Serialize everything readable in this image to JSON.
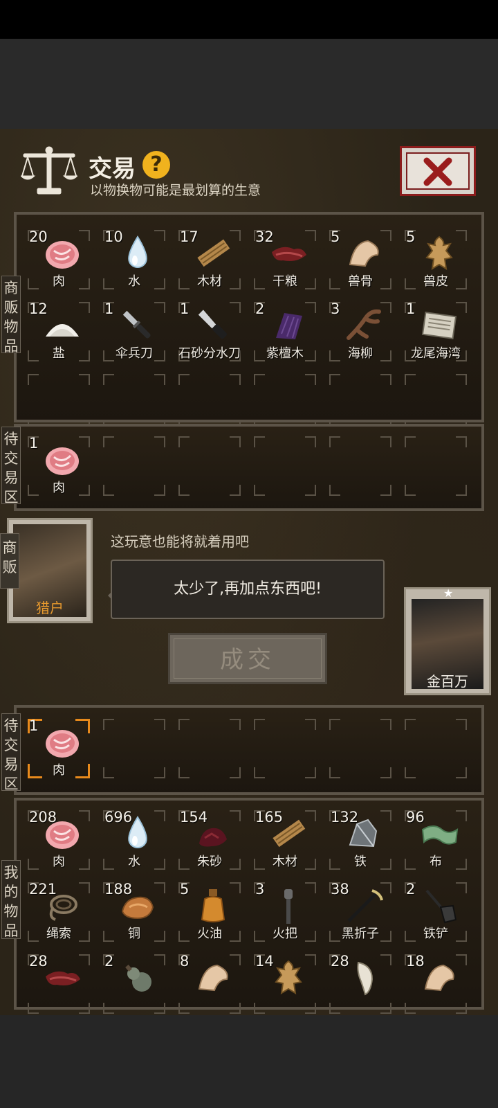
{
  "header": {
    "title": "交易",
    "help": "?",
    "subtitle": "以物换物可能是最划算的生意"
  },
  "labels": {
    "merchant_goods": "商贩物品",
    "pending_top": "待交易区",
    "merchant": "商贩",
    "pending_bottom": "待交易区",
    "my_goods": "我的物品"
  },
  "merchant_items": [
    {
      "qty": "20",
      "name": "肉",
      "icon": "meat-icon"
    },
    {
      "qty": "10",
      "name": "水",
      "icon": "water-icon"
    },
    {
      "qty": "17",
      "name": "木材",
      "icon": "wood-icon"
    },
    {
      "qty": "32",
      "name": "干粮",
      "icon": "jerky-icon"
    },
    {
      "qty": "5",
      "name": "兽骨",
      "icon": "bone-icon"
    },
    {
      "qty": "5",
      "name": "兽皮",
      "icon": "hide-icon"
    },
    {
      "qty": "12",
      "name": "盐",
      "icon": "salt-icon"
    },
    {
      "qty": "1",
      "name": "伞兵刀",
      "icon": "paratrooper-knife-icon"
    },
    {
      "qty": "1",
      "name": "石砂分水刀",
      "icon": "knife-icon"
    },
    {
      "qty": "2",
      "name": "紫檀木",
      "icon": "rosewood-icon"
    },
    {
      "qty": "3",
      "name": "海柳",
      "icon": "sea-willow-icon"
    },
    {
      "qty": "1",
      "name": "龙尾海湾",
      "icon": "map-icon"
    }
  ],
  "merchant_pending": [
    {
      "qty": "1",
      "name": "肉",
      "icon": "meat-icon"
    }
  ],
  "npc": {
    "name": "猎户",
    "line": "这玩意也能将就着用吧",
    "speech": "太少了,再加点东西吧!"
  },
  "deal_button": "成交",
  "player": {
    "name": "金百万"
  },
  "player_pending": [
    {
      "qty": "1",
      "name": "肉",
      "icon": "meat-icon"
    }
  ],
  "my_items": [
    {
      "qty": "208",
      "name": "肉",
      "icon": "meat-icon"
    },
    {
      "qty": "696",
      "name": "水",
      "icon": "water-icon"
    },
    {
      "qty": "154",
      "name": "朱砂",
      "icon": "cinnabar-icon"
    },
    {
      "qty": "165",
      "name": "木材",
      "icon": "wood-icon"
    },
    {
      "qty": "132",
      "name": "铁",
      "icon": "iron-icon"
    },
    {
      "qty": "96",
      "name": "布",
      "icon": "cloth-icon"
    },
    {
      "qty": "221",
      "name": "绳索",
      "icon": "rope-icon"
    },
    {
      "qty": "188",
      "name": "铜",
      "icon": "copper-icon"
    },
    {
      "qty": "5",
      "name": "火油",
      "icon": "kerosene-icon"
    },
    {
      "qty": "3",
      "name": "火把",
      "icon": "torch-icon"
    },
    {
      "qty": "38",
      "name": "黑折子",
      "icon": "black-tinder-icon"
    },
    {
      "qty": "2",
      "name": "铁铲",
      "icon": "shovel-icon"
    },
    {
      "qty": "28",
      "name": "",
      "icon": "jerky-icon"
    },
    {
      "qty": "2",
      "name": "",
      "icon": "gourd-icon"
    },
    {
      "qty": "8",
      "name": "",
      "icon": "bone-icon"
    },
    {
      "qty": "14",
      "name": "",
      "icon": "hide-icon"
    },
    {
      "qty": "28",
      "name": "",
      "icon": "tooth-icon"
    },
    {
      "qty": "18",
      "name": "",
      "icon": "bone-icon"
    }
  ]
}
